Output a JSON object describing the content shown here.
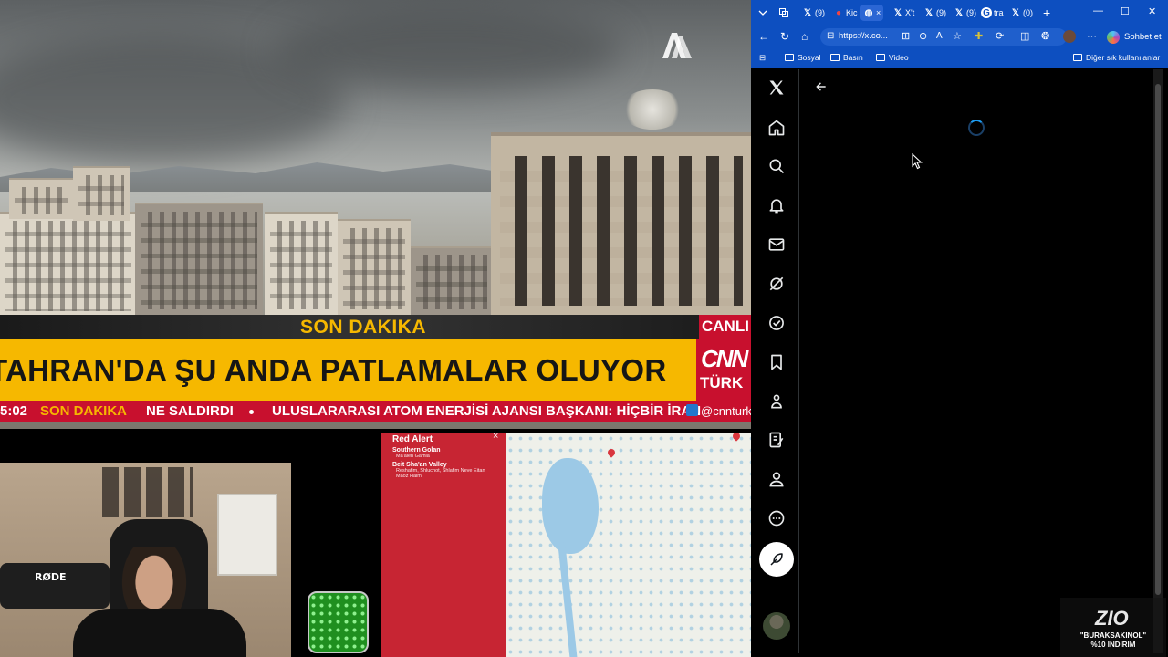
{
  "broadcast": {
    "son_dakika_label": "SON DAKIKA",
    "live_label": "CANLI",
    "headline": "TAHRAN'DA ŞU ANDA PATLAMALAR OLUYOR",
    "channel_top": "CNN",
    "channel_bottom": "TÜRK",
    "ticker": {
      "time": "5:02",
      "son_dakika": "SON DAKIKA",
      "item1": "NE SALDIRDI",
      "item2": "ULUSLARARASI ATOM ENERJİSİ AJANSI BAŞKANI: HİÇBİR İRAN",
      "handle": "@cnnturk"
    },
    "agency_logo": "AA"
  },
  "webcam": {
    "mic_brand": "RØDE"
  },
  "alert_map": {
    "title": "Red Alert",
    "close": "×",
    "regions": [
      {
        "name": "Southern Golan",
        "places": "Ma'aleh Gamla"
      },
      {
        "name": "Beit Sha'an Valley",
        "places": "Reshafim, Shluchot, Shlafim      Neve Eitan"
      },
      {
        "name": "",
        "places": "Maoz Haim"
      }
    ]
  },
  "browser": {
    "tabs": [
      {
        "icon": "x-icon",
        "label": "(9)"
      },
      {
        "icon": "kick-icon",
        "label": "Kic"
      },
      {
        "icon": "globe-icon",
        "label": "×"
      },
      {
        "icon": "x-icon",
        "label": "X't"
      },
      {
        "icon": "x-icon",
        "label": "(9)"
      },
      {
        "icon": "x-icon",
        "label": "(9)"
      },
      {
        "icon": "globe-icon",
        "label": "tra"
      },
      {
        "icon": "x-icon",
        "label": "(0)"
      }
    ],
    "new_tab": "+",
    "url": "https://x.co...",
    "chat_button": "Sohbet et",
    "bookmarks": [
      "Sosyal",
      "Basın",
      "Video"
    ],
    "other_bookmarks": "Diğer sık kullanılanlar"
  },
  "x_app": {
    "logo": "X",
    "nav_items": [
      "home-icon",
      "search-icon",
      "notifications-icon",
      "messages-icon",
      "grok-icon",
      "verified-icon",
      "bookmarks-icon",
      "communities-icon",
      "premium-icon",
      "profile-icon",
      "more-icon"
    ],
    "back": "←"
  },
  "promo": {
    "brand": "ZIO",
    "code": "\"BURAKSAKINOL\"",
    "discount": "%10 İNDİRİM"
  },
  "colors": {
    "cnn_red": "#c8102e",
    "son_dakika_yellow": "#f6b800",
    "edge_blue": "#0d4fc0",
    "x_blue": "#1d9bf0"
  }
}
